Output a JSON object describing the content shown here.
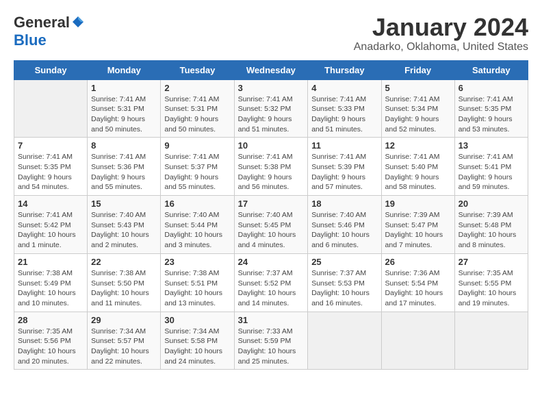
{
  "logo": {
    "general": "General",
    "blue": "Blue"
  },
  "title": "January 2024",
  "subtitle": "Anadarko, Oklahoma, United States",
  "headers": [
    "Sunday",
    "Monday",
    "Tuesday",
    "Wednesday",
    "Thursday",
    "Friday",
    "Saturday"
  ],
  "weeks": [
    [
      {
        "day": "",
        "info": ""
      },
      {
        "day": "1",
        "info": "Sunrise: 7:41 AM\nSunset: 5:31 PM\nDaylight: 9 hours\nand 50 minutes."
      },
      {
        "day": "2",
        "info": "Sunrise: 7:41 AM\nSunset: 5:31 PM\nDaylight: 9 hours\nand 50 minutes."
      },
      {
        "day": "3",
        "info": "Sunrise: 7:41 AM\nSunset: 5:32 PM\nDaylight: 9 hours\nand 51 minutes."
      },
      {
        "day": "4",
        "info": "Sunrise: 7:41 AM\nSunset: 5:33 PM\nDaylight: 9 hours\nand 51 minutes."
      },
      {
        "day": "5",
        "info": "Sunrise: 7:41 AM\nSunset: 5:34 PM\nDaylight: 9 hours\nand 52 minutes."
      },
      {
        "day": "6",
        "info": "Sunrise: 7:41 AM\nSunset: 5:35 PM\nDaylight: 9 hours\nand 53 minutes."
      }
    ],
    [
      {
        "day": "7",
        "info": "Sunrise: 7:41 AM\nSunset: 5:35 PM\nDaylight: 9 hours\nand 54 minutes."
      },
      {
        "day": "8",
        "info": "Sunrise: 7:41 AM\nSunset: 5:36 PM\nDaylight: 9 hours\nand 55 minutes."
      },
      {
        "day": "9",
        "info": "Sunrise: 7:41 AM\nSunset: 5:37 PM\nDaylight: 9 hours\nand 55 minutes."
      },
      {
        "day": "10",
        "info": "Sunrise: 7:41 AM\nSunset: 5:38 PM\nDaylight: 9 hours\nand 56 minutes."
      },
      {
        "day": "11",
        "info": "Sunrise: 7:41 AM\nSunset: 5:39 PM\nDaylight: 9 hours\nand 57 minutes."
      },
      {
        "day": "12",
        "info": "Sunrise: 7:41 AM\nSunset: 5:40 PM\nDaylight: 9 hours\nand 58 minutes."
      },
      {
        "day": "13",
        "info": "Sunrise: 7:41 AM\nSunset: 5:41 PM\nDaylight: 9 hours\nand 59 minutes."
      }
    ],
    [
      {
        "day": "14",
        "info": "Sunrise: 7:41 AM\nSunset: 5:42 PM\nDaylight: 10 hours\nand 1 minute."
      },
      {
        "day": "15",
        "info": "Sunrise: 7:40 AM\nSunset: 5:43 PM\nDaylight: 10 hours\nand 2 minutes."
      },
      {
        "day": "16",
        "info": "Sunrise: 7:40 AM\nSunset: 5:44 PM\nDaylight: 10 hours\nand 3 minutes."
      },
      {
        "day": "17",
        "info": "Sunrise: 7:40 AM\nSunset: 5:45 PM\nDaylight: 10 hours\nand 4 minutes."
      },
      {
        "day": "18",
        "info": "Sunrise: 7:40 AM\nSunset: 5:46 PM\nDaylight: 10 hours\nand 6 minutes."
      },
      {
        "day": "19",
        "info": "Sunrise: 7:39 AM\nSunset: 5:47 PM\nDaylight: 10 hours\nand 7 minutes."
      },
      {
        "day": "20",
        "info": "Sunrise: 7:39 AM\nSunset: 5:48 PM\nDaylight: 10 hours\nand 8 minutes."
      }
    ],
    [
      {
        "day": "21",
        "info": "Sunrise: 7:38 AM\nSunset: 5:49 PM\nDaylight: 10 hours\nand 10 minutes."
      },
      {
        "day": "22",
        "info": "Sunrise: 7:38 AM\nSunset: 5:50 PM\nDaylight: 10 hours\nand 11 minutes."
      },
      {
        "day": "23",
        "info": "Sunrise: 7:38 AM\nSunset: 5:51 PM\nDaylight: 10 hours\nand 13 minutes."
      },
      {
        "day": "24",
        "info": "Sunrise: 7:37 AM\nSunset: 5:52 PM\nDaylight: 10 hours\nand 14 minutes."
      },
      {
        "day": "25",
        "info": "Sunrise: 7:37 AM\nSunset: 5:53 PM\nDaylight: 10 hours\nand 16 minutes."
      },
      {
        "day": "26",
        "info": "Sunrise: 7:36 AM\nSunset: 5:54 PM\nDaylight: 10 hours\nand 17 minutes."
      },
      {
        "day": "27",
        "info": "Sunrise: 7:35 AM\nSunset: 5:55 PM\nDaylight: 10 hours\nand 19 minutes."
      }
    ],
    [
      {
        "day": "28",
        "info": "Sunrise: 7:35 AM\nSunset: 5:56 PM\nDaylight: 10 hours\nand 20 minutes."
      },
      {
        "day": "29",
        "info": "Sunrise: 7:34 AM\nSunset: 5:57 PM\nDaylight: 10 hours\nand 22 minutes."
      },
      {
        "day": "30",
        "info": "Sunrise: 7:34 AM\nSunset: 5:58 PM\nDaylight: 10 hours\nand 24 minutes."
      },
      {
        "day": "31",
        "info": "Sunrise: 7:33 AM\nSunset: 5:59 PM\nDaylight: 10 hours\nand 25 minutes."
      },
      {
        "day": "",
        "info": ""
      },
      {
        "day": "",
        "info": ""
      },
      {
        "day": "",
        "info": ""
      }
    ]
  ]
}
